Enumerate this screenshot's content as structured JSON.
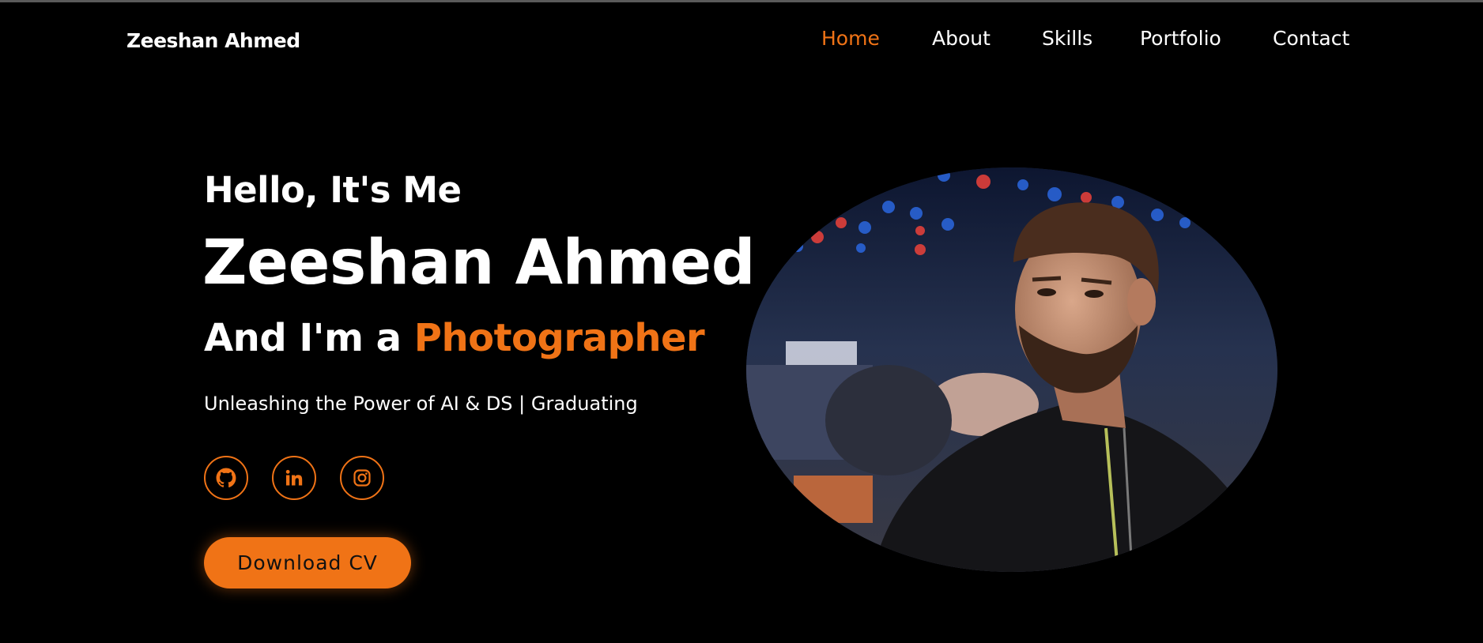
{
  "brand": {
    "name": "Zeeshan Ahmed"
  },
  "nav": {
    "items": [
      {
        "label": "Home",
        "active": true
      },
      {
        "label": "About",
        "active": false
      },
      {
        "label": "Skills",
        "active": false
      },
      {
        "label": "Portfolio",
        "active": false
      },
      {
        "label": "Contact",
        "active": false
      }
    ]
  },
  "hero": {
    "greeting": "Hello, It's Me",
    "name": "Zeeshan Ahmed",
    "role_prefix": "And I'm a ",
    "role": "Photographer",
    "tagline": "Unleashing the Power of AI & DS | Graduating",
    "cv_button": "Download CV",
    "socials": [
      {
        "icon": "github-icon"
      },
      {
        "icon": "linkedin-icon"
      },
      {
        "icon": "instagram-icon"
      }
    ],
    "portrait": {
      "description": "profile-photo"
    }
  },
  "colors": {
    "accent": "#f07316",
    "background": "#000000",
    "text": "#ffffff"
  }
}
